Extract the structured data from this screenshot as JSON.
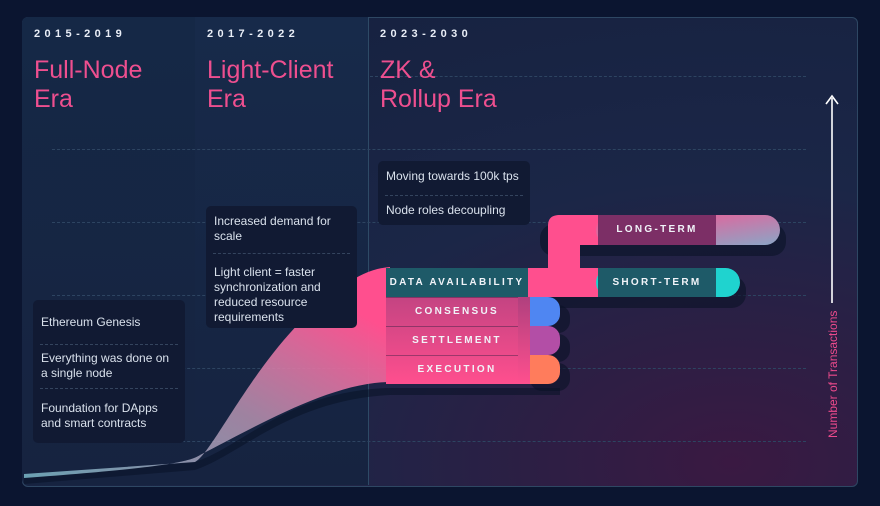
{
  "eras": [
    {
      "years": "2015-2019",
      "title_lines": [
        "Full-Node",
        "Era"
      ]
    },
    {
      "years": "2017-2022",
      "title_lines": [
        "Light-Client",
        "Era"
      ]
    },
    {
      "years": "2023-2030",
      "title_lines": [
        "ZK &",
        "Rollup Era"
      ]
    }
  ],
  "notes": {
    "full_node": [
      "Ethereum Genesis",
      "Everything was done on a single node",
      "Foundation for DApps and smart contracts"
    ],
    "light_client": [
      "Increased demand for scale",
      "Light client = faster synchronization and reduced resource requirements"
    ],
    "rollup": [
      "Moving towards 100k tps",
      "Node roles decoupling"
    ]
  },
  "layers": {
    "data_availability": "DATA AVAILABILITY",
    "consensus": "CONSENSUS",
    "settlement": "SETTLEMENT",
    "execution": "EXECUTION",
    "long_term": "LONG-TERM",
    "short_term": "SHORT-TERM"
  },
  "axis": {
    "label": "Number of Transactions"
  },
  "colors": {
    "pink": "#ff4f8e",
    "teal": "#1e5a68",
    "cyan": "#1fd3cf",
    "blue": "#4f86f2",
    "purple": "#b34ea6",
    "orange": "#ff7c5c"
  }
}
